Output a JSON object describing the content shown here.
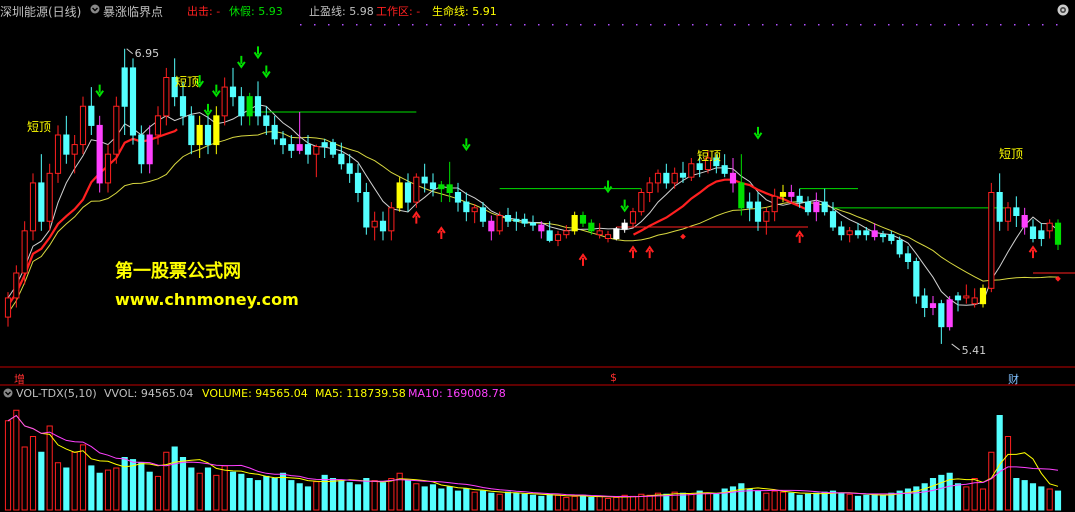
{
  "header": {
    "stock_name": "深圳能源(日线)",
    "indicator_name": "暴涨临界点",
    "exit_label": "出击: -",
    "rest_label": "休假: 5.93",
    "stop_label": "止盈线: 5.98",
    "work_label": "工作区: -",
    "life_label": "生命线: 5.91"
  },
  "volume_header": {
    "title": "VOL-TDX(5,10)",
    "vvol": "VVOL: 94565.04",
    "volume": "VOLUME: 94565.04",
    "ma5": "MA5: 118739.58",
    "ma10": "MA10: 169008.78"
  },
  "watermark": {
    "line1": "第一股票公式网",
    "line2": "www.chnmoney.com"
  },
  "axis_marks": {
    "left": "增",
    "mid": "$",
    "right": "财"
  },
  "colors": {
    "up_cyan": "#54ffff",
    "magenta": "#ff40ff",
    "yellow": "#ffff00",
    "green": "#00e000",
    "red": "#ff2020",
    "white": "#ffffff",
    "orange": "#ffa500",
    "axis_red": "#c00000"
  },
  "chart_data": {
    "type": "candlestick",
    "price_annotations": {
      "high": "6.95",
      "low": "5.41"
    },
    "signal_texts": [
      "短顶",
      "短顶",
      "短顶",
      "短顶"
    ],
    "candles": [
      {
        "o": 5.55,
        "h": 5.68,
        "l": 5.5,
        "c": 5.65,
        "k": "r"
      },
      {
        "o": 5.65,
        "h": 5.82,
        "l": 5.6,
        "c": 5.78,
        "k": "r"
      },
      {
        "o": 5.78,
        "h": 6.05,
        "l": 5.72,
        "c": 6.0,
        "k": "r"
      },
      {
        "o": 6.0,
        "h": 6.3,
        "l": 5.95,
        "c": 6.25,
        "k": "r"
      },
      {
        "o": 6.25,
        "h": 6.4,
        "l": 6.0,
        "c": 6.05,
        "k": "c"
      },
      {
        "o": 6.05,
        "h": 6.35,
        "l": 6.0,
        "c": 6.3,
        "k": "r"
      },
      {
        "o": 6.3,
        "h": 6.55,
        "l": 6.25,
        "c": 6.5,
        "k": "r"
      },
      {
        "o": 6.5,
        "h": 6.6,
        "l": 6.35,
        "c": 6.4,
        "k": "c"
      },
      {
        "o": 6.4,
        "h": 6.5,
        "l": 6.3,
        "c": 6.45,
        "k": "r"
      },
      {
        "o": 6.45,
        "h": 6.7,
        "l": 6.4,
        "c": 6.65,
        "k": "r"
      },
      {
        "o": 6.65,
        "h": 6.75,
        "l": 6.5,
        "c": 6.55,
        "k": "c"
      },
      {
        "o": 6.55,
        "h": 6.6,
        "l": 6.2,
        "c": 6.25,
        "k": "m"
      },
      {
        "o": 6.25,
        "h": 6.45,
        "l": 6.2,
        "c": 6.4,
        "k": "r"
      },
      {
        "o": 6.4,
        "h": 6.7,
        "l": 6.35,
        "c": 6.65,
        "k": "r"
      },
      {
        "o": 6.65,
        "h": 6.95,
        "l": 6.5,
        "c": 6.85,
        "k": "c"
      },
      {
        "o": 6.85,
        "h": 6.9,
        "l": 6.45,
        "c": 6.5,
        "k": "c"
      },
      {
        "o": 6.5,
        "h": 6.55,
        "l": 6.3,
        "c": 6.35,
        "k": "c"
      },
      {
        "o": 6.35,
        "h": 6.55,
        "l": 6.3,
        "c": 6.5,
        "k": "m"
      },
      {
        "o": 6.5,
        "h": 6.65,
        "l": 6.45,
        "c": 6.6,
        "k": "r"
      },
      {
        "o": 6.6,
        "h": 6.85,
        "l": 6.55,
        "c": 6.8,
        "k": "r"
      },
      {
        "o": 6.8,
        "h": 6.9,
        "l": 6.65,
        "c": 6.7,
        "k": "c"
      },
      {
        "o": 6.7,
        "h": 6.78,
        "l": 6.55,
        "c": 6.6,
        "k": "c"
      },
      {
        "o": 6.6,
        "h": 6.65,
        "l": 6.4,
        "c": 6.45,
        "k": "c"
      },
      {
        "o": 6.45,
        "h": 6.6,
        "l": 6.38,
        "c": 6.55,
        "k": "y"
      },
      {
        "o": 6.55,
        "h": 6.6,
        "l": 6.4,
        "c": 6.45,
        "k": "c"
      },
      {
        "o": 6.45,
        "h": 6.65,
        "l": 6.4,
        "c": 6.6,
        "k": "y"
      },
      {
        "o": 6.6,
        "h": 6.8,
        "l": 6.55,
        "c": 6.75,
        "k": "r"
      },
      {
        "o": 6.75,
        "h": 6.85,
        "l": 6.65,
        "c": 6.7,
        "k": "c"
      },
      {
        "o": 6.7,
        "h": 6.75,
        "l": 6.55,
        "c": 6.6,
        "k": "c"
      },
      {
        "o": 6.6,
        "h": 6.72,
        "l": 6.55,
        "c": 6.7,
        "k": "g"
      },
      {
        "o": 6.7,
        "h": 6.78,
        "l": 6.55,
        "c": 6.6,
        "k": "c"
      },
      {
        "o": 6.6,
        "h": 6.65,
        "l": 6.5,
        "c": 6.55,
        "k": "c"
      },
      {
        "o": 6.55,
        "h": 6.6,
        "l": 6.45,
        "c": 6.48,
        "k": "c"
      },
      {
        "o": 6.48,
        "h": 6.52,
        "l": 6.4,
        "c": 6.45,
        "k": "c"
      },
      {
        "o": 6.45,
        "h": 6.5,
        "l": 6.38,
        "c": 6.42,
        "k": "c"
      },
      {
        "o": 6.42,
        "h": 6.62,
        "l": 6.4,
        "c": 6.45,
        "k": "m"
      },
      {
        "o": 6.45,
        "h": 6.5,
        "l": 6.35,
        "c": 6.4,
        "k": "c"
      },
      {
        "o": 6.4,
        "h": 6.45,
        "l": 6.28,
        "c": 6.44,
        "k": "r"
      },
      {
        "o": 6.44,
        "h": 6.48,
        "l": 6.38,
        "c": 6.46,
        "k": "c"
      },
      {
        "o": 6.46,
        "h": 6.48,
        "l": 6.38,
        "c": 6.4,
        "k": "c"
      },
      {
        "o": 6.4,
        "h": 6.46,
        "l": 6.32,
        "c": 6.35,
        "k": "c"
      },
      {
        "o": 6.35,
        "h": 6.4,
        "l": 6.25,
        "c": 6.3,
        "k": "c"
      },
      {
        "o": 6.3,
        "h": 6.35,
        "l": 6.15,
        "c": 6.2,
        "k": "c"
      },
      {
        "o": 6.2,
        "h": 6.25,
        "l": 5.98,
        "c": 6.02,
        "k": "c"
      },
      {
        "o": 6.02,
        "h": 6.1,
        "l": 5.95,
        "c": 6.05,
        "k": "r"
      },
      {
        "o": 6.05,
        "h": 6.1,
        "l": 5.95,
        "c": 6.0,
        "k": "c"
      },
      {
        "o": 6.0,
        "h": 6.15,
        "l": 5.95,
        "c": 6.12,
        "k": "r"
      },
      {
        "o": 6.12,
        "h": 6.28,
        "l": 6.1,
        "c": 6.25,
        "k": "y"
      },
      {
        "o": 6.25,
        "h": 6.3,
        "l": 6.1,
        "c": 6.15,
        "k": "c"
      },
      {
        "o": 6.15,
        "h": 6.3,
        "l": 6.12,
        "c": 6.28,
        "k": "r"
      },
      {
        "o": 6.28,
        "h": 6.35,
        "l": 6.2,
        "c": 6.25,
        "k": "c"
      },
      {
        "o": 6.25,
        "h": 6.3,
        "l": 6.18,
        "c": 6.22,
        "k": "c"
      },
      {
        "o": 6.22,
        "h": 6.26,
        "l": 6.15,
        "c": 6.24,
        "k": "g"
      },
      {
        "o": 6.24,
        "h": 6.36,
        "l": 6.15,
        "c": 6.2,
        "k": "g"
      },
      {
        "o": 6.2,
        "h": 6.25,
        "l": 6.1,
        "c": 6.15,
        "k": "c"
      },
      {
        "o": 6.15,
        "h": 6.2,
        "l": 6.05,
        "c": 6.1,
        "k": "c"
      },
      {
        "o": 6.1,
        "h": 6.14,
        "l": 6.04,
        "c": 6.12,
        "k": "r"
      },
      {
        "o": 6.12,
        "h": 6.15,
        "l": 6.02,
        "c": 6.05,
        "k": "c"
      },
      {
        "o": 6.05,
        "h": 6.08,
        "l": 5.95,
        "c": 6.0,
        "k": "m"
      },
      {
        "o": 6.0,
        "h": 6.1,
        "l": 5.98,
        "c": 6.08,
        "k": "r"
      },
      {
        "o": 6.08,
        "h": 6.12,
        "l": 6.02,
        "c": 6.05,
        "k": "c"
      },
      {
        "o": 6.05,
        "h": 6.1,
        "l": 6.0,
        "c": 6.06,
        "k": "c"
      },
      {
        "o": 6.06,
        "h": 6.09,
        "l": 6.02,
        "c": 6.04,
        "k": "c"
      },
      {
        "o": 6.04,
        "h": 6.08,
        "l": 6.0,
        "c": 6.03,
        "k": "c"
      },
      {
        "o": 6.03,
        "h": 6.05,
        "l": 5.96,
        "c": 6.0,
        "k": "m"
      },
      {
        "o": 6.0,
        "h": 6.05,
        "l": 5.94,
        "c": 5.95,
        "k": "c"
      },
      {
        "o": 5.95,
        "h": 6.0,
        "l": 5.92,
        "c": 5.98,
        "k": "r"
      },
      {
        "o": 5.98,
        "h": 6.03,
        "l": 5.96,
        "c": 6.0,
        "k": "r"
      },
      {
        "o": 6.0,
        "h": 6.1,
        "l": 5.98,
        "c": 6.08,
        "k": "y"
      },
      {
        "o": 6.08,
        "h": 6.1,
        "l": 6.02,
        "c": 6.04,
        "k": "g"
      },
      {
        "o": 6.04,
        "h": 6.06,
        "l": 5.98,
        "c": 6.0,
        "k": "g"
      },
      {
        "o": 6.0,
        "h": 6.04,
        "l": 5.96,
        "c": 5.98,
        "k": "r"
      },
      {
        "o": 5.98,
        "h": 6.0,
        "l": 5.94,
        "c": 5.96,
        "k": "r"
      },
      {
        "o": 5.96,
        "h": 6.02,
        "l": 5.95,
        "c": 6.01,
        "k": "w"
      },
      {
        "o": 6.01,
        "h": 6.06,
        "l": 5.99,
        "c": 6.04,
        "k": "w"
      },
      {
        "o": 6.04,
        "h": 6.12,
        "l": 6.02,
        "c": 6.1,
        "k": "r"
      },
      {
        "o": 6.1,
        "h": 6.22,
        "l": 6.08,
        "c": 6.2,
        "k": "r"
      },
      {
        "o": 6.2,
        "h": 6.28,
        "l": 6.15,
        "c": 6.25,
        "k": "r"
      },
      {
        "o": 6.25,
        "h": 6.32,
        "l": 6.2,
        "c": 6.3,
        "k": "r"
      },
      {
        "o": 6.3,
        "h": 6.35,
        "l": 6.22,
        "c": 6.25,
        "k": "c"
      },
      {
        "o": 6.25,
        "h": 6.33,
        "l": 6.22,
        "c": 6.3,
        "k": "r"
      },
      {
        "o": 6.3,
        "h": 6.36,
        "l": 6.25,
        "c": 6.28,
        "k": "c"
      },
      {
        "o": 6.28,
        "h": 6.38,
        "l": 6.26,
        "c": 6.35,
        "k": "r"
      },
      {
        "o": 6.35,
        "h": 6.4,
        "l": 6.28,
        "c": 6.32,
        "k": "c"
      },
      {
        "o": 6.32,
        "h": 6.42,
        "l": 6.3,
        "c": 6.38,
        "k": "r"
      },
      {
        "o": 6.38,
        "h": 6.4,
        "l": 6.3,
        "c": 6.34,
        "k": "c"
      },
      {
        "o": 6.34,
        "h": 6.4,
        "l": 6.28,
        "c": 6.3,
        "k": "c"
      },
      {
        "o": 6.3,
        "h": 6.38,
        "l": 6.2,
        "c": 6.25,
        "k": "m"
      },
      {
        "o": 6.25,
        "h": 6.4,
        "l": 6.08,
        "c": 6.12,
        "k": "g"
      },
      {
        "o": 6.12,
        "h": 6.2,
        "l": 6.05,
        "c": 6.15,
        "k": "c"
      },
      {
        "o": 6.15,
        "h": 6.2,
        "l": 6.0,
        "c": 6.05,
        "k": "c"
      },
      {
        "o": 6.05,
        "h": 6.12,
        "l": 5.98,
        "c": 6.1,
        "k": "r"
      },
      {
        "o": 6.1,
        "h": 6.22,
        "l": 6.05,
        "c": 6.18,
        "k": "r"
      },
      {
        "o": 6.18,
        "h": 6.24,
        "l": 6.15,
        "c": 6.2,
        "k": "y"
      },
      {
        "o": 6.2,
        "h": 6.24,
        "l": 6.15,
        "c": 6.18,
        "k": "m"
      },
      {
        "o": 6.18,
        "h": 6.22,
        "l": 6.12,
        "c": 6.15,
        "k": "c"
      },
      {
        "o": 6.15,
        "h": 6.18,
        "l": 6.08,
        "c": 6.1,
        "k": "c"
      },
      {
        "o": 6.1,
        "h": 6.2,
        "l": 6.05,
        "c": 6.15,
        "k": "m"
      },
      {
        "o": 6.15,
        "h": 6.22,
        "l": 6.08,
        "c": 6.1,
        "k": "c"
      },
      {
        "o": 6.1,
        "h": 6.15,
        "l": 6.0,
        "c": 6.02,
        "k": "c"
      },
      {
        "o": 6.02,
        "h": 6.05,
        "l": 5.95,
        "c": 5.98,
        "k": "c"
      },
      {
        "o": 5.98,
        "h": 6.02,
        "l": 5.94,
        "c": 6.0,
        "k": "r"
      },
      {
        "o": 6.0,
        "h": 6.04,
        "l": 5.96,
        "c": 5.98,
        "k": "c"
      },
      {
        "o": 5.98,
        "h": 6.02,
        "l": 5.95,
        "c": 6.0,
        "k": "c"
      },
      {
        "o": 6.0,
        "h": 6.04,
        "l": 5.95,
        "c": 5.97,
        "k": "m"
      },
      {
        "o": 5.97,
        "h": 6.0,
        "l": 5.94,
        "c": 5.98,
        "k": "c"
      },
      {
        "o": 5.98,
        "h": 6.0,
        "l": 5.93,
        "c": 5.95,
        "k": "c"
      },
      {
        "o": 5.95,
        "h": 5.97,
        "l": 5.86,
        "c": 5.88,
        "k": "c"
      },
      {
        "o": 5.88,
        "h": 5.92,
        "l": 5.8,
        "c": 5.84,
        "k": "c"
      },
      {
        "o": 5.84,
        "h": 5.86,
        "l": 5.62,
        "c": 5.66,
        "k": "c"
      },
      {
        "o": 5.66,
        "h": 5.7,
        "l": 5.55,
        "c": 5.6,
        "k": "c"
      },
      {
        "o": 5.6,
        "h": 5.66,
        "l": 5.56,
        "c": 5.62,
        "k": "m"
      },
      {
        "o": 5.62,
        "h": 5.64,
        "l": 5.41,
        "c": 5.5,
        "k": "c"
      },
      {
        "o": 5.5,
        "h": 5.66,
        "l": 5.48,
        "c": 5.64,
        "k": "m"
      },
      {
        "o": 5.64,
        "h": 5.68,
        "l": 5.58,
        "c": 5.66,
        "k": "c"
      },
      {
        "o": 5.66,
        "h": 5.72,
        "l": 5.62,
        "c": 5.65,
        "k": "r"
      },
      {
        "o": 5.65,
        "h": 5.7,
        "l": 5.6,
        "c": 5.62,
        "k": "r"
      },
      {
        "o": 5.62,
        "h": 5.72,
        "l": 5.6,
        "c": 5.7,
        "k": "y"
      },
      {
        "o": 5.7,
        "h": 6.25,
        "l": 5.68,
        "c": 6.2,
        "k": "r"
      },
      {
        "o": 6.2,
        "h": 6.3,
        "l": 6.0,
        "c": 6.05,
        "k": "c"
      },
      {
        "o": 6.05,
        "h": 6.15,
        "l": 6.0,
        "c": 6.12,
        "k": "r"
      },
      {
        "o": 6.12,
        "h": 6.18,
        "l": 6.02,
        "c": 6.08,
        "k": "c"
      },
      {
        "o": 6.08,
        "h": 6.12,
        "l": 5.98,
        "c": 6.02,
        "k": "m"
      },
      {
        "o": 6.02,
        "h": 6.06,
        "l": 5.94,
        "c": 5.96,
        "k": "c"
      },
      {
        "o": 5.96,
        "h": 6.04,
        "l": 5.92,
        "c": 6.0,
        "k": "c"
      },
      {
        "o": 6.0,
        "h": 6.06,
        "l": 5.96,
        "c": 6.04,
        "k": "r"
      },
      {
        "o": 6.04,
        "h": 6.06,
        "l": 5.9,
        "c": 5.93,
        "k": "g"
      }
    ],
    "volume": {
      "title": "VOL-TDX(5,10)",
      "series_names": [
        "MA5",
        "MA10"
      ],
      "bars_relative": [
        0.85,
        0.95,
        0.6,
        0.7,
        0.55,
        0.8,
        0.45,
        0.4,
        0.55,
        0.62,
        0.42,
        0.35,
        0.38,
        0.4,
        0.5,
        0.48,
        0.45,
        0.36,
        0.32,
        0.55,
        0.6,
        0.5,
        0.4,
        0.35,
        0.4,
        0.33,
        0.42,
        0.36,
        0.34,
        0.3,
        0.28,
        0.32,
        0.3,
        0.35,
        0.28,
        0.25,
        0.22,
        0.27,
        0.33,
        0.3,
        0.28,
        0.26,
        0.24,
        0.3,
        0.28,
        0.26,
        0.3,
        0.35,
        0.28,
        0.25,
        0.22,
        0.24,
        0.2,
        0.22,
        0.18,
        0.2,
        0.17,
        0.18,
        0.16,
        0.15,
        0.17,
        0.16,
        0.15,
        0.14,
        0.13,
        0.15,
        0.14,
        0.12,
        0.13,
        0.14,
        0.12,
        0.13,
        0.11,
        0.12,
        0.14,
        0.13,
        0.15,
        0.14,
        0.16,
        0.15,
        0.17,
        0.16,
        0.15,
        0.18,
        0.16,
        0.15,
        0.2,
        0.22,
        0.25,
        0.2,
        0.18,
        0.16,
        0.18,
        0.17,
        0.16,
        0.14,
        0.15,
        0.16,
        0.17,
        0.18,
        0.16,
        0.15,
        0.13,
        0.14,
        0.15,
        0.14,
        0.16,
        0.18,
        0.2,
        0.22,
        0.25,
        0.3,
        0.33,
        0.35,
        0.25,
        0.22,
        0.3,
        0.2,
        0.55,
        0.9,
        0.7,
        0.3,
        0.28,
        0.25,
        0.22,
        0.2,
        0.18
      ],
      "kinds": "mixed"
    }
  }
}
